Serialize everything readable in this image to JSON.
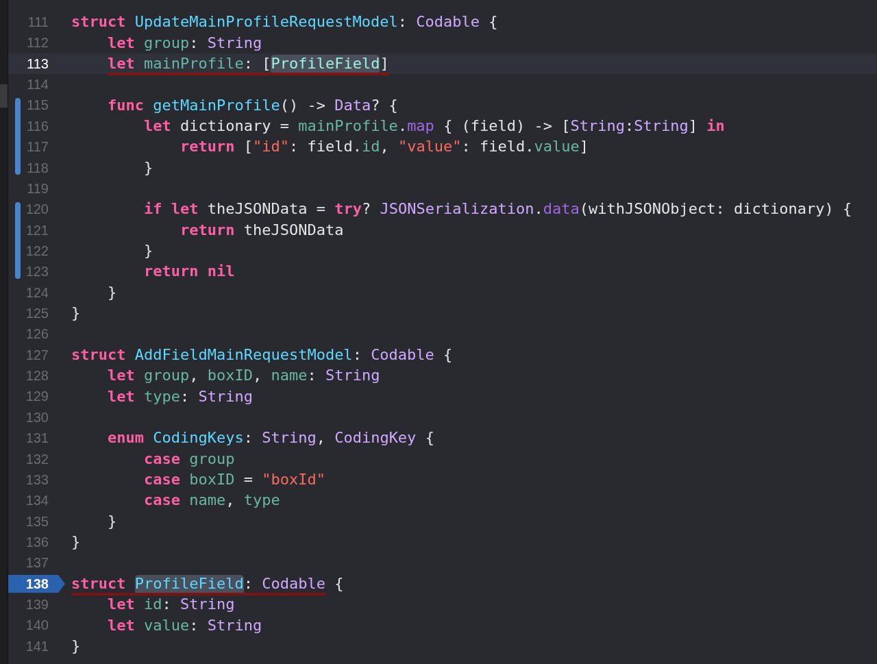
{
  "editor": {
    "lines": [
      {
        "number": "111",
        "current": false,
        "changed": false,
        "breakpoint": false,
        "tokens": [
          {
            "text": "struct",
            "kind": "kw"
          },
          {
            "text": " UpdateMainProfileRequestModel",
            "kind": "decl"
          },
          {
            "text": ":",
            "kind": "plain"
          },
          {
            "text": " Codable",
            "kind": "type"
          },
          {
            "text": " {",
            "kind": "plain"
          }
        ]
      },
      {
        "number": "112",
        "current": false,
        "changed": false,
        "breakpoint": false,
        "tokens": [
          {
            "text": "    let",
            "kind": "kw"
          },
          {
            "text": " group",
            "kind": "prop"
          },
          {
            "text": ":",
            "kind": "plain"
          },
          {
            "text": " String",
            "kind": "type"
          }
        ]
      },
      {
        "number": "113",
        "current": true,
        "changed": false,
        "breakpoint": false,
        "tokens": [
          {
            "text": "    let",
            "kind": "kw",
            "underlined": true
          },
          {
            "text": " mainProfile",
            "kind": "prop",
            "underlined": true
          },
          {
            "text": ": [",
            "kind": "plain",
            "underlined": true
          },
          {
            "text": "ProfileField",
            "kind": "projtype",
            "highlighted": true,
            "underlined": true
          },
          {
            "text": "]",
            "kind": "plain",
            "underlined": true
          }
        ]
      },
      {
        "number": "114",
        "current": false,
        "changed": false,
        "breakpoint": false
      },
      {
        "number": "115",
        "current": false,
        "changed": true,
        "breakpoint": false,
        "tokens": [
          {
            "text": "    func",
            "kind": "kw"
          },
          {
            "text": " getMainProfile",
            "kind": "decl"
          },
          {
            "text": "() ->",
            "kind": "plain"
          },
          {
            "text": " Data",
            "kind": "type"
          },
          {
            "text": "? {",
            "kind": "plain"
          }
        ]
      },
      {
        "number": "116",
        "current": false,
        "changed": true,
        "breakpoint": false,
        "tokens": [
          {
            "text": "        let",
            "kind": "kw"
          },
          {
            "text": " dictionary =",
            "kind": "plain"
          },
          {
            "text": " mainProfile",
            "kind": "prop"
          },
          {
            "text": ".",
            "kind": "plain"
          },
          {
            "text": "map",
            "kind": "sysmethod"
          },
          {
            "text": " { (field) -> [",
            "kind": "plain"
          },
          {
            "text": "String",
            "kind": "type"
          },
          {
            "text": ":",
            "kind": "plain"
          },
          {
            "text": "String",
            "kind": "type"
          },
          {
            "text": "]",
            "kind": "plain"
          },
          {
            "text": " in",
            "kind": "kw"
          }
        ]
      },
      {
        "number": "117",
        "current": false,
        "changed": true,
        "breakpoint": false,
        "tokens": [
          {
            "text": "            return",
            "kind": "kw"
          },
          {
            "text": " [",
            "kind": "plain"
          },
          {
            "text": "\"id\"",
            "kind": "str"
          },
          {
            "text": ": field.",
            "kind": "plain"
          },
          {
            "text": "id",
            "kind": "prop"
          },
          {
            "text": ",",
            "kind": "plain"
          },
          {
            "text": " \"value\"",
            "kind": "str"
          },
          {
            "text": ": field.",
            "kind": "plain"
          },
          {
            "text": "value",
            "kind": "prop"
          },
          {
            "text": "]",
            "kind": "plain"
          }
        ]
      },
      {
        "number": "118",
        "current": false,
        "changed": true,
        "breakpoint": false,
        "tokens": [
          {
            "text": "        }",
            "kind": "plain"
          }
        ]
      },
      {
        "number": "119",
        "current": false,
        "changed": false,
        "breakpoint": false
      },
      {
        "number": "120",
        "current": false,
        "changed": true,
        "breakpoint": false,
        "tokens": [
          {
            "text": "        if",
            "kind": "kw"
          },
          {
            "text": " let",
            "kind": "kw"
          },
          {
            "text": " theJSONData =",
            "kind": "plain"
          },
          {
            "text": " try",
            "kind": "kw"
          },
          {
            "text": "?",
            "kind": "plain"
          },
          {
            "text": " JSONSerialization",
            "kind": "type"
          },
          {
            "text": ".",
            "kind": "plain"
          },
          {
            "text": "data",
            "kind": "sysmethod"
          },
          {
            "text": "(withJSONObject: dictionary) {",
            "kind": "plain"
          }
        ]
      },
      {
        "number": "121",
        "current": false,
        "changed": true,
        "breakpoint": false,
        "tokens": [
          {
            "text": "            return",
            "kind": "kw"
          },
          {
            "text": " theJSONData",
            "kind": "plain"
          }
        ]
      },
      {
        "number": "122",
        "current": false,
        "changed": true,
        "breakpoint": false,
        "tokens": [
          {
            "text": "        }",
            "kind": "plain"
          }
        ]
      },
      {
        "number": "123",
        "current": false,
        "changed": true,
        "breakpoint": false,
        "tokens": [
          {
            "text": "        return",
            "kind": "kw"
          },
          {
            "text": " nil",
            "kind": "kw"
          }
        ]
      },
      {
        "number": "124",
        "current": false,
        "changed": false,
        "breakpoint": false,
        "tokens": [
          {
            "text": "    }",
            "kind": "plain"
          }
        ]
      },
      {
        "number": "125",
        "current": false,
        "changed": false,
        "breakpoint": false,
        "tokens": [
          {
            "text": "}",
            "kind": "plain"
          }
        ]
      },
      {
        "number": "126",
        "current": false,
        "changed": false,
        "breakpoint": false
      },
      {
        "number": "127",
        "current": false,
        "changed": false,
        "breakpoint": false,
        "tokens": [
          {
            "text": "struct",
            "kind": "kw"
          },
          {
            "text": " AddFieldMainRequestModel",
            "kind": "decl"
          },
          {
            "text": ":",
            "kind": "plain"
          },
          {
            "text": " Codable",
            "kind": "type"
          },
          {
            "text": " {",
            "kind": "plain"
          }
        ]
      },
      {
        "number": "128",
        "current": false,
        "changed": false,
        "breakpoint": false,
        "tokens": [
          {
            "text": "    let",
            "kind": "kw"
          },
          {
            "text": " group",
            "kind": "prop"
          },
          {
            "text": ",",
            "kind": "plain"
          },
          {
            "text": " boxID",
            "kind": "prop"
          },
          {
            "text": ",",
            "kind": "plain"
          },
          {
            "text": " name",
            "kind": "prop"
          },
          {
            "text": ":",
            "kind": "plain"
          },
          {
            "text": " String",
            "kind": "type"
          }
        ]
      },
      {
        "number": "129",
        "current": false,
        "changed": false,
        "breakpoint": false,
        "tokens": [
          {
            "text": "    let",
            "kind": "kw"
          },
          {
            "text": " type",
            "kind": "prop"
          },
          {
            "text": ":",
            "kind": "plain"
          },
          {
            "text": " String",
            "kind": "type"
          }
        ]
      },
      {
        "number": "130",
        "current": false,
        "changed": false,
        "breakpoint": false
      },
      {
        "number": "131",
        "current": false,
        "changed": false,
        "breakpoint": false,
        "tokens": [
          {
            "text": "    enum",
            "kind": "kw"
          },
          {
            "text": " CodingKeys",
            "kind": "decl"
          },
          {
            "text": ":",
            "kind": "plain"
          },
          {
            "text": " String",
            "kind": "type"
          },
          {
            "text": ",",
            "kind": "plain"
          },
          {
            "text": " CodingKey",
            "kind": "type"
          },
          {
            "text": " {",
            "kind": "plain"
          }
        ]
      },
      {
        "number": "132",
        "current": false,
        "changed": false,
        "breakpoint": false,
        "tokens": [
          {
            "text": "        case",
            "kind": "kw"
          },
          {
            "text": " group",
            "kind": "prop"
          }
        ]
      },
      {
        "number": "133",
        "current": false,
        "changed": false,
        "breakpoint": false,
        "tokens": [
          {
            "text": "        case",
            "kind": "kw"
          },
          {
            "text": " boxID",
            "kind": "prop"
          },
          {
            "text": " =",
            "kind": "plain"
          },
          {
            "text": " \"boxId\"",
            "kind": "str"
          }
        ]
      },
      {
        "number": "134",
        "current": false,
        "changed": false,
        "breakpoint": false,
        "tokens": [
          {
            "text": "        case",
            "kind": "kw"
          },
          {
            "text": " name",
            "kind": "prop"
          },
          {
            "text": ",",
            "kind": "plain"
          },
          {
            "text": " type",
            "kind": "prop"
          }
        ]
      },
      {
        "number": "135",
        "current": false,
        "changed": false,
        "breakpoint": false,
        "tokens": [
          {
            "text": "    }",
            "kind": "plain"
          }
        ]
      },
      {
        "number": "136",
        "current": false,
        "changed": false,
        "breakpoint": false,
        "tokens": [
          {
            "text": "}",
            "kind": "plain"
          }
        ]
      },
      {
        "number": "137",
        "current": false,
        "changed": false,
        "breakpoint": false
      },
      {
        "number": "138",
        "current": false,
        "changed": false,
        "breakpoint": true,
        "tokens": [
          {
            "text": "struct",
            "kind": "kw",
            "underlined": true
          },
          {
            "text": " ProfileField",
            "kind": "decl",
            "highlighted": true,
            "underlined": true
          },
          {
            "text": ":",
            "kind": "plain",
            "underlined": true
          },
          {
            "text": " Codable",
            "kind": "type",
            "underlined": true
          },
          {
            "text": " {",
            "kind": "plain"
          }
        ]
      },
      {
        "number": "139",
        "current": false,
        "changed": false,
        "breakpoint": false,
        "tokens": [
          {
            "text": "    let",
            "kind": "kw"
          },
          {
            "text": " id",
            "kind": "prop"
          },
          {
            "text": ":",
            "kind": "plain"
          },
          {
            "text": " String",
            "kind": "type"
          }
        ]
      },
      {
        "number": "140",
        "current": false,
        "changed": false,
        "breakpoint": false,
        "tokens": [
          {
            "text": "    let",
            "kind": "kw"
          },
          {
            "text": " value",
            "kind": "prop"
          },
          {
            "text": ":",
            "kind": "plain"
          },
          {
            "text": " String",
            "kind": "type"
          }
        ]
      },
      {
        "number": "141",
        "current": false,
        "changed": false,
        "breakpoint": false,
        "tokens": [
          {
            "text": "}",
            "kind": "plain"
          }
        ]
      }
    ]
  }
}
